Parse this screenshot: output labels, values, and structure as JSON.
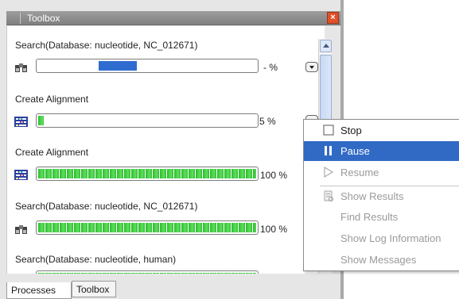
{
  "toolbox": {
    "title": "Toolbox",
    "close_symbol": "×"
  },
  "processes": [
    {
      "title": "Search(Database: nucleotide, NC_012671)",
      "icon": "binoculars-icon",
      "progress_display": "- %",
      "bar_style": "indeterminate"
    },
    {
      "title": "Create Alignment",
      "icon": "alignment-icon",
      "progress_display": "5 %",
      "progress": 0.05,
      "bar_style": "blocks"
    },
    {
      "title": "Create Alignment",
      "icon": "alignment-icon",
      "progress_display": "100 %",
      "progress": 1.0,
      "bar_style": "blocks"
    },
    {
      "title": "Search(Database: nucleotide, NC_012671)",
      "icon": "binoculars-icon",
      "progress_display": "100 %",
      "progress": 1.0,
      "bar_style": "blocks"
    },
    {
      "title": "Search(Database: nucleotide, human)",
      "icon": "binoculars-icon",
      "progress_display": "",
      "bar_style": "blocks"
    }
  ],
  "tabs": [
    {
      "label": "Processes",
      "active": true
    },
    {
      "label": "Toolbox",
      "active": false
    }
  ],
  "context_menu": {
    "items": [
      {
        "label": "Stop",
        "icon": "stop-icon",
        "enabled": true,
        "highlighted": false
      },
      {
        "label": "Pause",
        "icon": "pause-icon",
        "enabled": true,
        "highlighted": true
      },
      {
        "label": "Resume",
        "icon": "resume-icon",
        "enabled": false,
        "highlighted": false
      },
      {
        "label": "Show Results",
        "icon": "show-results-icon",
        "enabled": false,
        "highlighted": false
      },
      {
        "label": "Find Results",
        "icon": "",
        "enabled": false,
        "highlighted": false
      },
      {
        "label": "Show Log Information",
        "icon": "",
        "enabled": false,
        "highlighted": false
      },
      {
        "label": "Show Messages",
        "icon": "",
        "enabled": false,
        "highlighted": false
      }
    ]
  },
  "colors": {
    "highlight": "#316ac5",
    "progress_blue": "#2f6ccf",
    "progress_green": "#2dbb2d",
    "close_red": "#e0502a"
  }
}
